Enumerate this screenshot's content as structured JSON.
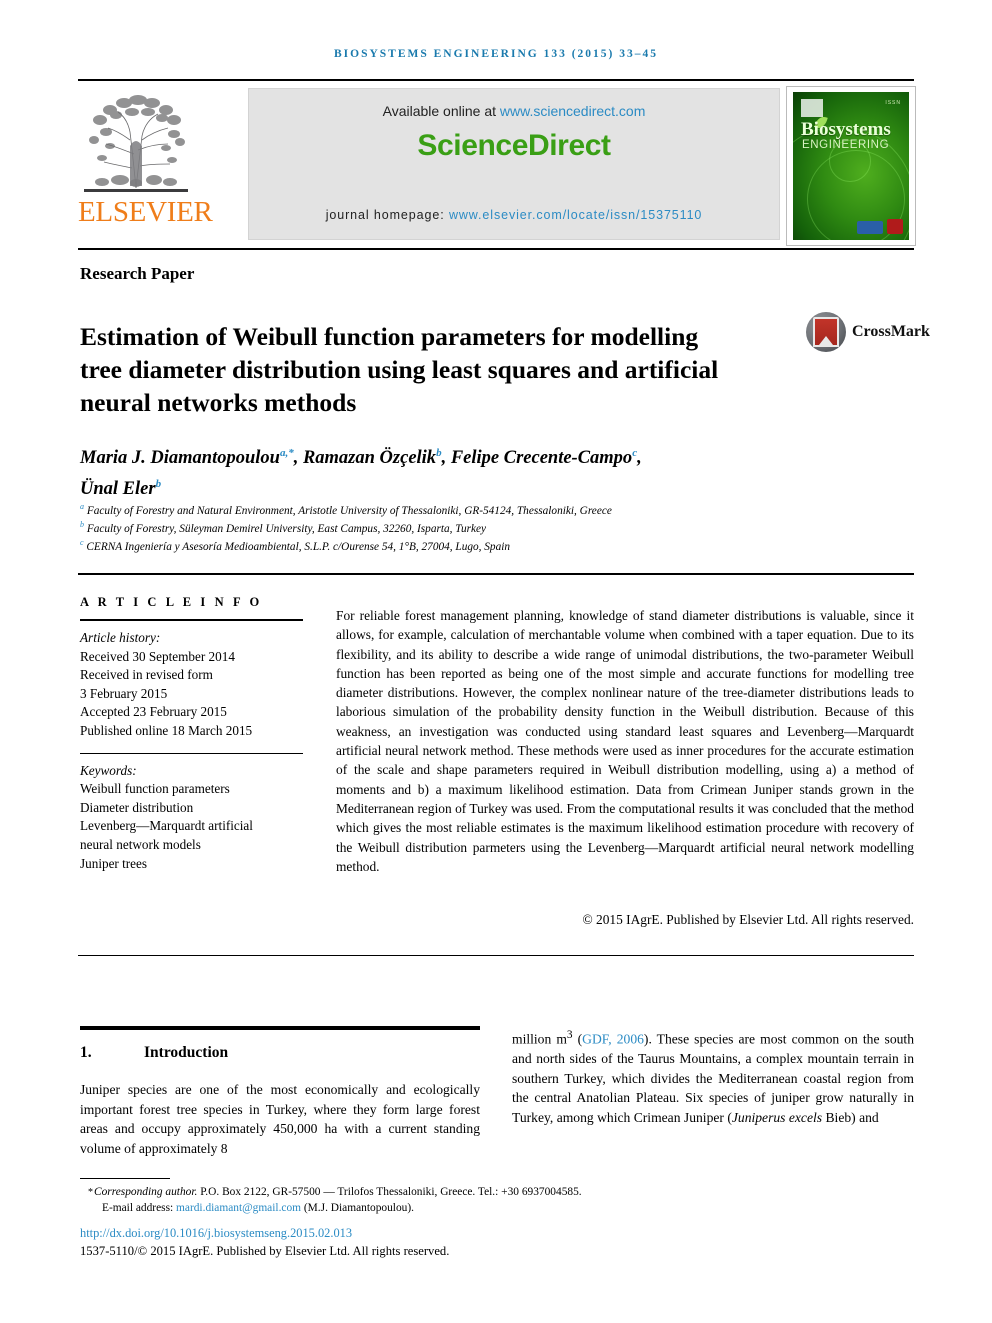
{
  "running_head": "BIOSYSTEMS ENGINEERING 133 (2015) 33–45",
  "masthead": {
    "publisher_name": "ELSEVIER",
    "available_prefix": "Available online at ",
    "available_url": "www.sciencedirect.com",
    "sciencedirect_logo": "ScienceDirect",
    "homepage_prefix": "journal homepage: ",
    "homepage_url": "www.elsevier.com/locate/issn/15375110",
    "cover": {
      "title": "Biosystems",
      "subtitle": "ENGINEERING",
      "issn_mark": "ISSN"
    },
    "colors": {
      "elsevier_orange": "#ef7d1a",
      "sciencedirect_green": "#3a9f15",
      "link_blue": "#2b8bc4",
      "runhead_blue": "#1a7aad"
    }
  },
  "article": {
    "type": "Research Paper",
    "title": "Estimation of Weibull function parameters for modelling tree diameter distribution using least squares and artificial neural networks methods",
    "crossmark_label": "CrossMark",
    "authors_line1": "Maria J. Diamantopoulou",
    "authors_sup1": "a,*",
    "authors_line1b": ", Ramazan Özçelik",
    "authors_sup2": "b",
    "authors_line1c": ", Felipe Crecente-Campo",
    "authors_sup3": "c",
    "authors_line1d": ",",
    "authors_line2": "Ünal Eler",
    "authors_sup4": "b",
    "affiliations": [
      {
        "mark": "a",
        "text": "Faculty of Forestry and Natural Environment, Aristotle University of Thessaloniki, GR-54124, Thessaloniki, Greece"
      },
      {
        "mark": "b",
        "text": "Faculty of Forestry, Süleyman Demirel University, East Campus, 32260, Isparta, Turkey"
      },
      {
        "mark": "c",
        "text": "CERNA Ingeniería y Asesoría Medioambiental, S.L.P. c/Ourense 54, 1°B, 27004, Lugo, Spain"
      }
    ]
  },
  "article_info": {
    "heading": "A R T I C L E   I N F O",
    "history_label": "Article history:",
    "history": [
      "Received 30 September 2014",
      "Received in revised form",
      "3 February 2015",
      "Accepted 23 February 2015",
      "Published online 18 March 2015"
    ],
    "keywords_label": "Keywords:",
    "keywords": [
      "Weibull function parameters",
      "Diameter distribution",
      "Levenberg—Marquardt artificial",
      "neural network models",
      "Juniper trees"
    ]
  },
  "abstract": {
    "text": "For reliable forest management planning, knowledge of stand diameter distributions is valuable, since it allows, for example, calculation of merchantable volume when combined with a taper equation. Due to its flexibility, and its ability to describe a wide range of unimodal distributions, the two-parameter Weibull function has been reported as being one of the most simple and accurate functions for modelling tree diameter distributions. However, the complex nonlinear nature of the tree-diameter distributions leads to laborious simulation of the probability density function in the Weibull distribution. Because of this weakness, an investigation was conducted using standard least squares and Levenberg—Marquardt artificial neural network method. These methods were used as inner procedures for the accurate estimation of the scale and shape parameters required in Weibull distribution modelling, using a) a method of moments and b) a maximum likelihood estimation. Data from Crimean Juniper stands grown in the Mediterranean region of Turkey was used. From the computational results it was concluded that the method which gives the most reliable estimates is the maximum likelihood estimation procedure with recovery of the Weibull distribution parmeters using the Levenberg—Marquardt artificial neural network modelling method.",
    "copyright": "© 2015 IAgrE. Published by Elsevier Ltd. All rights reserved."
  },
  "body": {
    "section_number": "1.",
    "section_title": "Introduction",
    "left_paragraph": "Juniper species are one of the most economically and ecologically important forest tree species in Turkey, where they form large forest areas and occupy approximately 450,000 ha with a current standing volume of approximately 8",
    "right_paragraph_pre": "million m",
    "right_paragraph_sup": "3",
    "right_paragraph_mid": " (",
    "right_citation": "GDF, 2006",
    "right_paragraph_post": "). These species are most common on the south and north sides of the Taurus Mountains, a complex mountain terrain in southern Turkey, which divides the Mediterranean coastal region from the central Anatolian Plateau. Six species of juniper grow naturally in Turkey, among which Crimean Juniper (",
    "right_italic": "Juniperus excels",
    "right_paragraph_end": " Bieb) and"
  },
  "footer": {
    "star": "*",
    "corresponding_italic": "Corresponding author.",
    "corresponding_rest": " P.O. Box 2122, GR-57500 — Trilofos Thessaloniki, Greece. Tel.: +30 6937004585.",
    "email_label": "E-mail address:",
    "email": "mardi.diamant@gmail.com",
    "email_owner": "(M.J. Diamantopoulou).",
    "doi": "http://dx.doi.org/10.1016/j.biosystemseng.2015.02.013",
    "issn_line": "1537-5110/© 2015 IAgrE. Published by Elsevier Ltd. All rights reserved."
  }
}
